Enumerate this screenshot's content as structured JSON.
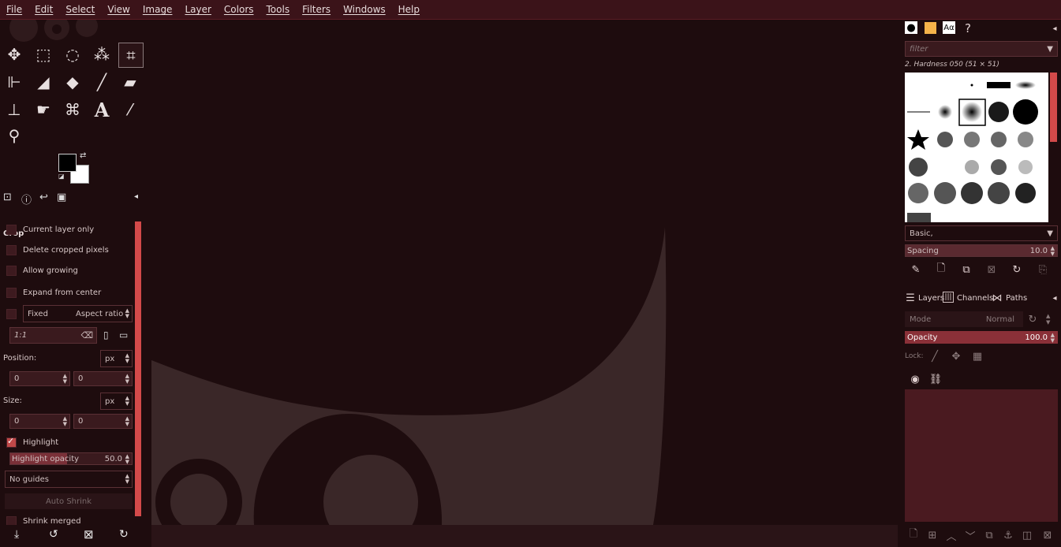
{
  "menubar": {
    "items": [
      "File",
      "Edit",
      "Select",
      "View",
      "Image",
      "Layer",
      "Colors",
      "Tools",
      "Filters",
      "Windows",
      "Help"
    ]
  },
  "toolbox": {
    "tools": [
      {
        "name": "move-tool-icon",
        "glyph": "✥"
      },
      {
        "name": "rect-select-tool-icon",
        "glyph": "▭"
      },
      {
        "name": "lasso-tool-icon",
        "glyph": "◌"
      },
      {
        "name": "fuzzy-select-tool-icon",
        "glyph": "✦"
      },
      {
        "name": "crop-tool-icon",
        "glyph": "⌗"
      },
      {
        "name": "transform-tool-icon",
        "glyph": "⊢"
      },
      {
        "name": "warp-tool-icon",
        "glyph": "◢"
      },
      {
        "name": "bucket-fill-tool-icon",
        "glyph": "◆"
      },
      {
        "name": "paintbrush-tool-icon",
        "glyph": "╱"
      },
      {
        "name": "eraser-tool-icon",
        "glyph": "▰"
      },
      {
        "name": "clone-tool-icon",
        "glyph": "⊥"
      },
      {
        "name": "smudge-tool-icon",
        "glyph": "☛"
      },
      {
        "name": "paths-tool-icon",
        "glyph": "⌘"
      },
      {
        "name": "text-tool-icon",
        "glyph": "A"
      },
      {
        "name": "color-picker-tool-icon",
        "glyph": "⁄"
      },
      {
        "name": "zoom-tool-icon",
        "glyph": "⚲"
      }
    ]
  },
  "tool_options": {
    "title": "Crop",
    "current_layer_only": "Current layer only",
    "delete_cropped": "Delete cropped pixels",
    "allow_growing": "Allow growing",
    "expand_from_center": "Expand from center",
    "fixed": "Fixed",
    "aspect_ratio": "Aspect ratio",
    "ratio_value": "1:1",
    "position_label": "Position:",
    "position_unit": "px",
    "position_x": "0",
    "position_y": "0",
    "size_label": "Size:",
    "size_unit": "px",
    "size_w": "0",
    "size_h": "0",
    "highlight": "Highlight",
    "highlight_opacity_label": "Highlight opacity",
    "highlight_opacity_value": "50.0",
    "guides": "No guides",
    "auto_shrink": "Auto Shrink",
    "shrink_merged": "Shrink merged"
  },
  "brushes": {
    "filter_placeholder": "filter",
    "selected_brush": "2. Hardness 050 (51 × 51)",
    "preset": "Basic,",
    "spacing_label": "Spacing",
    "spacing_value": "10.0"
  },
  "layers": {
    "tabs": [
      "Layers",
      "Channels",
      "Paths"
    ],
    "mode_label": "Mode",
    "mode_value": "Normal",
    "opacity_label": "Opacity",
    "opacity_value": "100.0",
    "lock_label": "Lock:"
  },
  "font_tab_label": "Aα",
  "colors": {
    "accent": "#d34a4a",
    "bg": "#1e0c0e",
    "menubar": "#3b1319"
  }
}
